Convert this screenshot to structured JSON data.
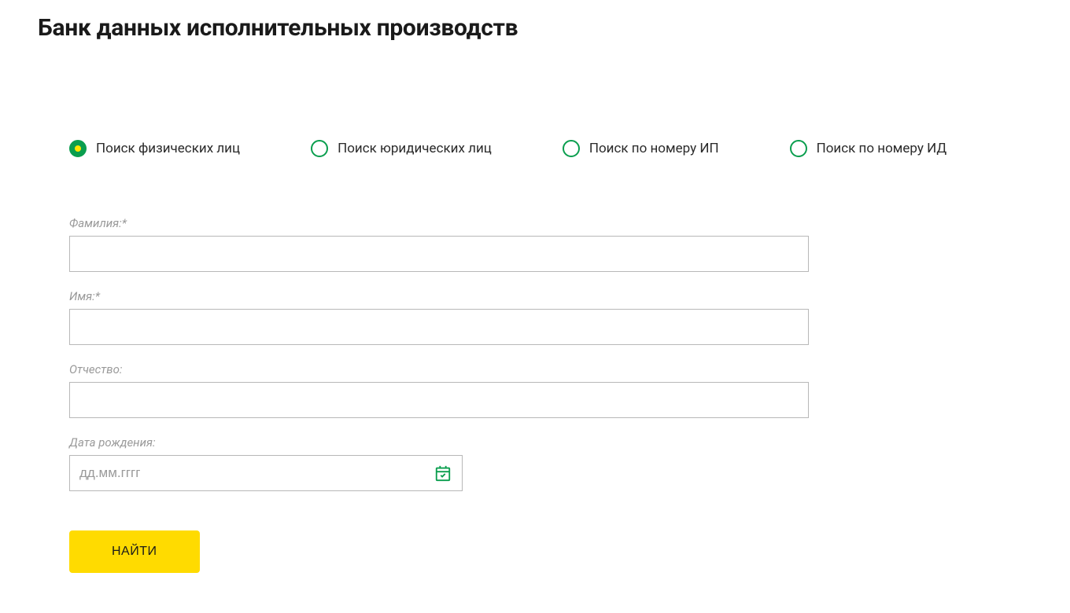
{
  "title": "Банк данных исполнительных производств",
  "radios": [
    {
      "label": "Поиск физических лиц",
      "selected": true
    },
    {
      "label": "Поиск юридических лиц",
      "selected": false
    },
    {
      "label": "Поиск по номеру ИП",
      "selected": false
    },
    {
      "label": "Поиск по номеру ИД",
      "selected": false
    }
  ],
  "fields": {
    "lastname": {
      "label": "Фамилия:*",
      "value": ""
    },
    "firstname": {
      "label": "Имя:*",
      "value": ""
    },
    "patronymic": {
      "label": "Отчество:",
      "value": ""
    },
    "birthdate": {
      "label": "Дата рождения:",
      "placeholder": "дд.мм.гггг",
      "value": ""
    }
  },
  "submit_label": "НАЙТИ"
}
